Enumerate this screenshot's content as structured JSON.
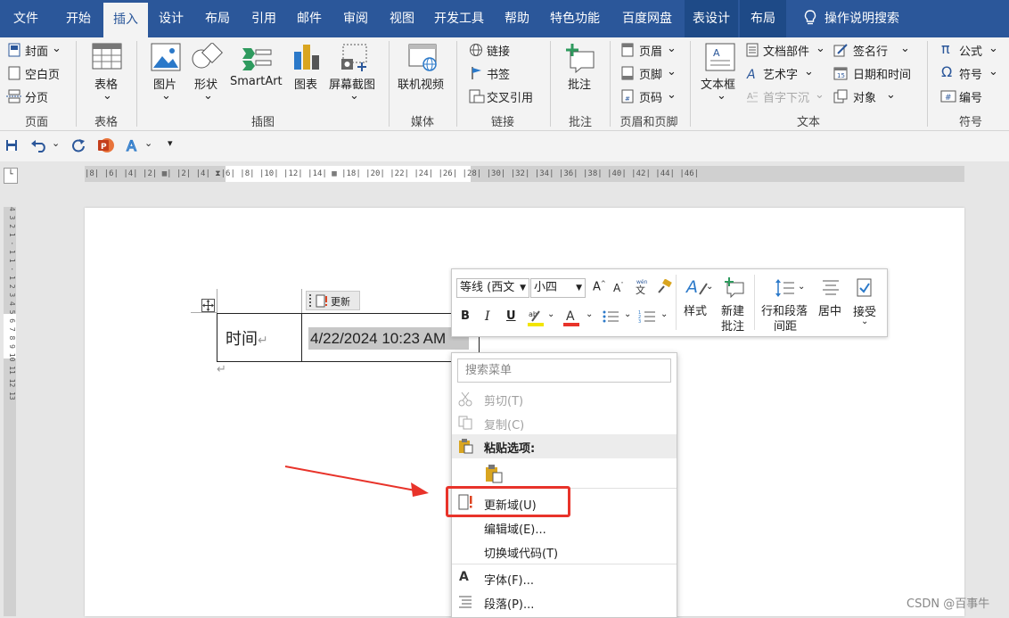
{
  "tabs": [
    {
      "label": "文件"
    },
    {
      "label": "开始"
    },
    {
      "label": "插入"
    },
    {
      "label": "设计"
    },
    {
      "label": "布局"
    },
    {
      "label": "引用"
    },
    {
      "label": "邮件"
    },
    {
      "label": "审阅"
    },
    {
      "label": "视图"
    },
    {
      "label": "开发工具"
    },
    {
      "label": "帮助"
    },
    {
      "label": "特色功能"
    },
    {
      "label": "百度网盘"
    },
    {
      "label": "表设计"
    },
    {
      "label": "布局"
    }
  ],
  "tell_me": "操作说明搜索",
  "ribbon": {
    "pages": {
      "cover": "封面",
      "blank": "空白页",
      "break": "分页",
      "group": "页面"
    },
    "tables": {
      "table": "表格",
      "group": "表格"
    },
    "illustrations": {
      "picture": "图片",
      "shapes": "形状",
      "smartart": "SmartArt",
      "chart": "图表",
      "screenshot": "屏幕截图",
      "group": "插图"
    },
    "media": {
      "video": "联机视频",
      "group": "媒体"
    },
    "links": {
      "link": "链接",
      "bookmark": "书签",
      "crossref": "交叉引用",
      "group": "链接"
    },
    "comments": {
      "comment": "批注",
      "group": "批注"
    },
    "header_footer": {
      "header": "页眉",
      "footer": "页脚",
      "page_number": "页码",
      "group": "页眉和页脚"
    },
    "text": {
      "textbox": "文本框",
      "quickparts": "文档部件",
      "wordart": "艺术字",
      "dropcap": "首字下沉",
      "signature": "签名行",
      "datetime": "日期和时间",
      "object": "对象",
      "group": "文本"
    },
    "symbols": {
      "equation": "公式",
      "symbol": "符号",
      "number": "编号",
      "group": "符号"
    }
  },
  "ruler": {
    "h_text": "|8|  |6|  |4|  |2| ▦|  |2|  |4| ⧗|6|  |8|  |10|  |12|  |14|  ▦ |18|  |20|  |22|  |24|  |26|  |28|  |30|  |32|  |34|  |36|  |38|  |40|  |42|  |44|  |46|",
    "v_text": "4 3 2 1 · 1 1 · 1 2 3 4 5 6 7 8 9 10 11 12 13"
  },
  "document": {
    "cell_label": "时间",
    "return_mark": "↵",
    "field_value": "4/22/2024 10:23 AM",
    "update_tag": "更新"
  },
  "mini_toolbar": {
    "font_name": "等线 (西文",
    "font_size": "小四",
    "styles": "样式",
    "new_comment_1": "新建",
    "new_comment_2": "批注",
    "line_spacing_1": "行和段落",
    "line_spacing_2": "间距",
    "center": "居中",
    "accept": "接受",
    "bold": "B",
    "italic": "I",
    "underline": "U"
  },
  "context_menu": {
    "search_placeholder": "搜索菜单",
    "cut": "剪切(T)",
    "copy": "复制(C)",
    "paste_options": "粘贴选项:",
    "update_field": "更新域(U)",
    "edit_field": "编辑域(E)...",
    "toggle_codes": "切换域代码(T)",
    "font": "字体(F)...",
    "paragraph": "段落(P)..."
  },
  "watermark": "CSDN @百事牛",
  "colors": {
    "accent": "#2b579a",
    "highlight_box": "#e8332a",
    "arrow": "#e8332a"
  }
}
